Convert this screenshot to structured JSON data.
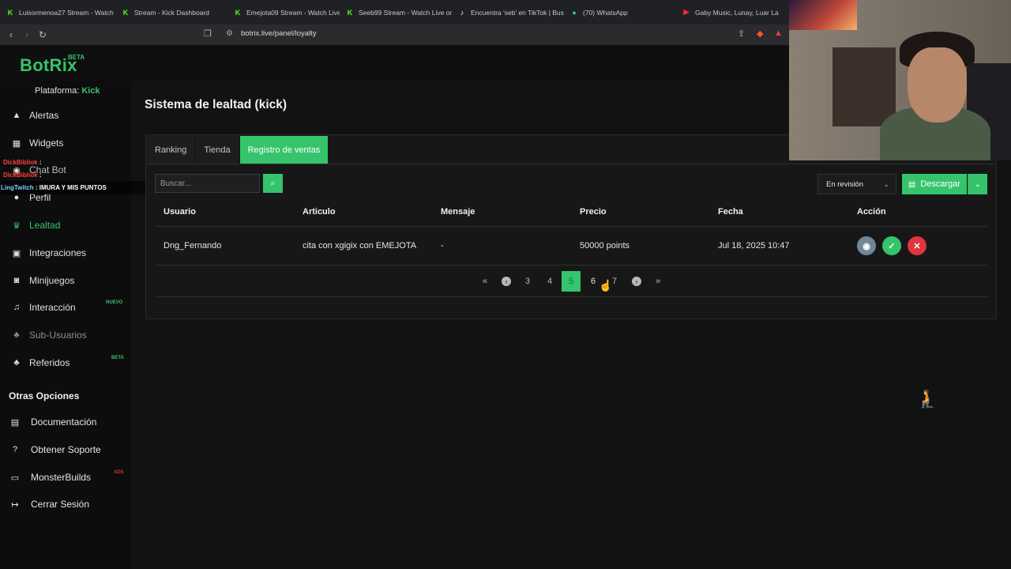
{
  "browser": {
    "tabs": [
      {
        "title": "Luisormenoa27 Stream - Watch",
        "icon": "kick"
      },
      {
        "title": "Stream - Kick Dashboard",
        "icon": "kick"
      },
      {
        "title": "Emejota09 Stream - Watch Live",
        "icon": "kick"
      },
      {
        "title": "Seeb99 Stream - Watch Live or",
        "icon": "kick"
      },
      {
        "title": "Encuentra 'seb' en TikTok | Bus",
        "icon": "tiktok"
      },
      {
        "title": "(70) WhatsApp",
        "icon": "whatsapp"
      },
      {
        "title": "Gaby Music, Lunay, Luar La",
        "icon": "youtube"
      }
    ],
    "url": "botrix.live/panel/loyalty"
  },
  "brand": {
    "name": "BotRix",
    "badge": "BETA",
    "accent": "#35c46b"
  },
  "platform": {
    "label": "Plataforma:",
    "value": "Kick"
  },
  "sidebar": {
    "items": [
      {
        "label": "Alertas",
        "icon": "warning-icon"
      },
      {
        "label": "Widgets",
        "icon": "grid-icon"
      },
      {
        "label": "Chat Bot",
        "icon": "robot-icon"
      },
      {
        "label": "Perfil",
        "icon": "user-icon"
      },
      {
        "label": "Lealtad",
        "icon": "trophy-icon"
      },
      {
        "label": "Integraciones",
        "icon": "plug-icon"
      },
      {
        "label": "Minijuegos",
        "icon": "gamepad-icon"
      },
      {
        "label": "Interacción",
        "icon": "music-icon",
        "badge": "NUEVO"
      },
      {
        "label": "Sub-Usuarios",
        "icon": "users-icon"
      },
      {
        "label": "Referidos",
        "icon": "users-icon",
        "badge": "BETA"
      }
    ],
    "section_title": "Otras Opciones",
    "options": [
      {
        "label": "Documentación",
        "icon": "book-icon"
      },
      {
        "label": "Obtener Soporte",
        "icon": "question-icon"
      },
      {
        "label": "MonsterBuilds",
        "icon": "laptop-icon",
        "badge": "ADS"
      },
      {
        "label": "Cerrar Sesión",
        "icon": "logout-icon"
      }
    ]
  },
  "chat_overlay": [
    {
      "user": "DickBibliok",
      "message": ":"
    },
    {
      "user": "DickBibliok",
      "message": ":"
    },
    {
      "user": "LingTwitch",
      "message": ": IMURA Y MIS PUNTOS"
    }
  ],
  "main": {
    "title": "Sistema de lealtad (kick)",
    "tabs": [
      "Ranking",
      "Tienda",
      "Registro de ventas"
    ],
    "active_tab": "Registro de ventas",
    "search_placeholder": "Buscar...",
    "filter_value": "En revisión",
    "download_label": "Descargar",
    "table": {
      "headers": [
        "Usuario",
        "Articulo",
        "Mensaje",
        "Precio",
        "Fecha",
        "Acción"
      ],
      "rows": [
        {
          "usuario": "Dng_Fernando",
          "articulo": "cita con xgigix con EMEJOTA",
          "mensaje": "-",
          "precio": "50000 points",
          "fecha": "Jul 18, 2025 10:47"
        }
      ]
    },
    "pagination": {
      "pages": [
        "3",
        "4",
        "5",
        "6",
        "7"
      ],
      "current": "5"
    }
  }
}
